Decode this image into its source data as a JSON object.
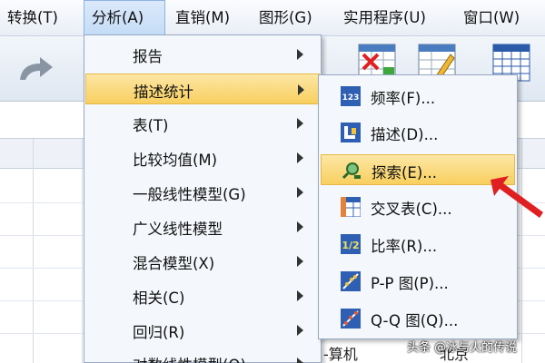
{
  "menubar": {
    "items": [
      {
        "label": "转换(T)"
      },
      {
        "label": "分析(A)"
      },
      {
        "label": "直销(M)"
      },
      {
        "label": "图形(G)"
      },
      {
        "label": "实用程序(U)"
      },
      {
        "label": "窗口(W)"
      }
    ]
  },
  "analyze_menu": {
    "items": [
      {
        "label": "报告"
      },
      {
        "label": "描述统计"
      },
      {
        "label": "表(T)"
      },
      {
        "label": "比较均值(M)"
      },
      {
        "label": "一般线性模型(G)"
      },
      {
        "label": "广义线性模型"
      },
      {
        "label": "混合模型(X)"
      },
      {
        "label": "相关(C)"
      },
      {
        "label": "回归(R)"
      },
      {
        "label": "对数线性模型(O)"
      }
    ]
  },
  "descriptive_submenu": {
    "items": [
      {
        "label": "频率(F)...",
        "icon": "frequencies-icon"
      },
      {
        "label": "描述(D)...",
        "icon": "descriptives-icon"
      },
      {
        "label": "探索(E)...",
        "icon": "explore-icon"
      },
      {
        "label": "交叉表(C)...",
        "icon": "crosstabs-icon"
      },
      {
        "label": "比率(R)...",
        "icon": "ratio-icon"
      },
      {
        "label": "P-P 图(P)...",
        "icon": "pp-plot-icon"
      },
      {
        "label": "Q-Q 图(Q)...",
        "icon": "qq-plot-icon"
      }
    ]
  },
  "data_view": {
    "cell_text": "-算机",
    "partial_text": "北京"
  },
  "watermark": "头条 @冰与火的传说",
  "colors": {
    "highlight": "#f8cf5f",
    "menu_bg": "#f4f7fb",
    "arrow": "#e02020"
  }
}
